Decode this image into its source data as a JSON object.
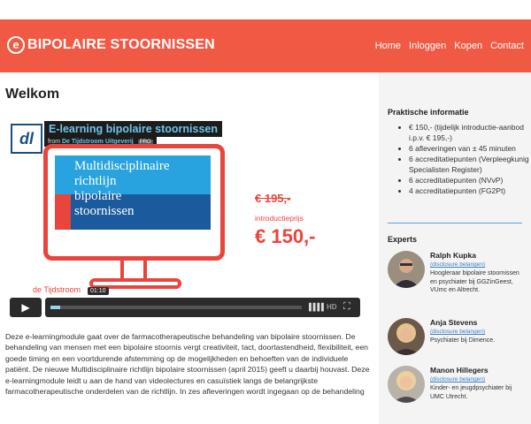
{
  "header": {
    "logo_mark": "e",
    "logo_text": "BIPOLAIRE STOORNISSEN",
    "nav": [
      "Home",
      "Inloggen",
      "Kopen",
      "Contact"
    ],
    "brand_color": "#f05a44"
  },
  "main": {
    "title": "Welkom",
    "video": {
      "logo": "dl",
      "title": "E-learning bipolaire stoornissen",
      "from_label": "from",
      "from_name": "De Tijdstroom Uitgeverij",
      "pro_badge": "PRO",
      "screen_text": [
        "Multidisciplinaire",
        "richtlijn",
        "bipolaire",
        "stoornissen"
      ],
      "old_price": "€ 195,-",
      "promo_label": "introductieprijs",
      "price": "€ 150,-",
      "brand": "de Tijdstroom",
      "time": "01:10",
      "progress": 0.04,
      "hd_label": "HD",
      "play_icon": "play-icon",
      "volume_icon": "volume-icon",
      "fullscreen_icon": "fullscreen-icon"
    },
    "description": "Deze e-learningmodule gaat over de farmacotherapeutische behandeling van bipolaire stoornissen. De behandeling van mensen met een bipolaire stoornis vergt creativiteit, tact, doortastendheid, flexibiliteit, een goede timing en een voortdurende afstemming op de mogelijkheden en behoeften van de individuele patiënt. De nieuwe Multidisciplinaire richtlijn bipolaire stoornissen (april 2015) geeft u daarbij houvast. Deze e-learningmodule leidt u aan de hand van videolectures en casuïstiek langs de belangrijkste farmacotherapeutische onderdelen van de richtlijn. In zes afleveringen wordt ingegaan op de behandeling"
  },
  "sidebar": {
    "info_title": "Praktische informatie",
    "info_items": [
      "€ 150,- (tijdelijk introductie-aanbod i.p.v. € 195,-)",
      "6 afleveringen van ± 45 minuten",
      "6 accreditatiepunten (Verpleegkunig Specialisten Register)",
      "6 accreditatiepunten (NVvP)",
      "4 accreditatiepunten (FG2Pt)"
    ],
    "experts_title": "Experts",
    "experts": [
      {
        "name": "Ralph Kupka",
        "link": "(disclosure belangen)",
        "description": "Hoogleraar bipolaire stoornissen en psychiater bij GGZinGeest, VUmc en Altrecht."
      },
      {
        "name": "Anja Stevens",
        "link": "(disclosure belangen)",
        "description": "Psychiater bij Dimence."
      },
      {
        "name": "Manon Hillegers",
        "link": "(disclosure belangen)",
        "description": "Kinder- en jeugdpsychiater bij UMC Utrecht."
      }
    ]
  }
}
